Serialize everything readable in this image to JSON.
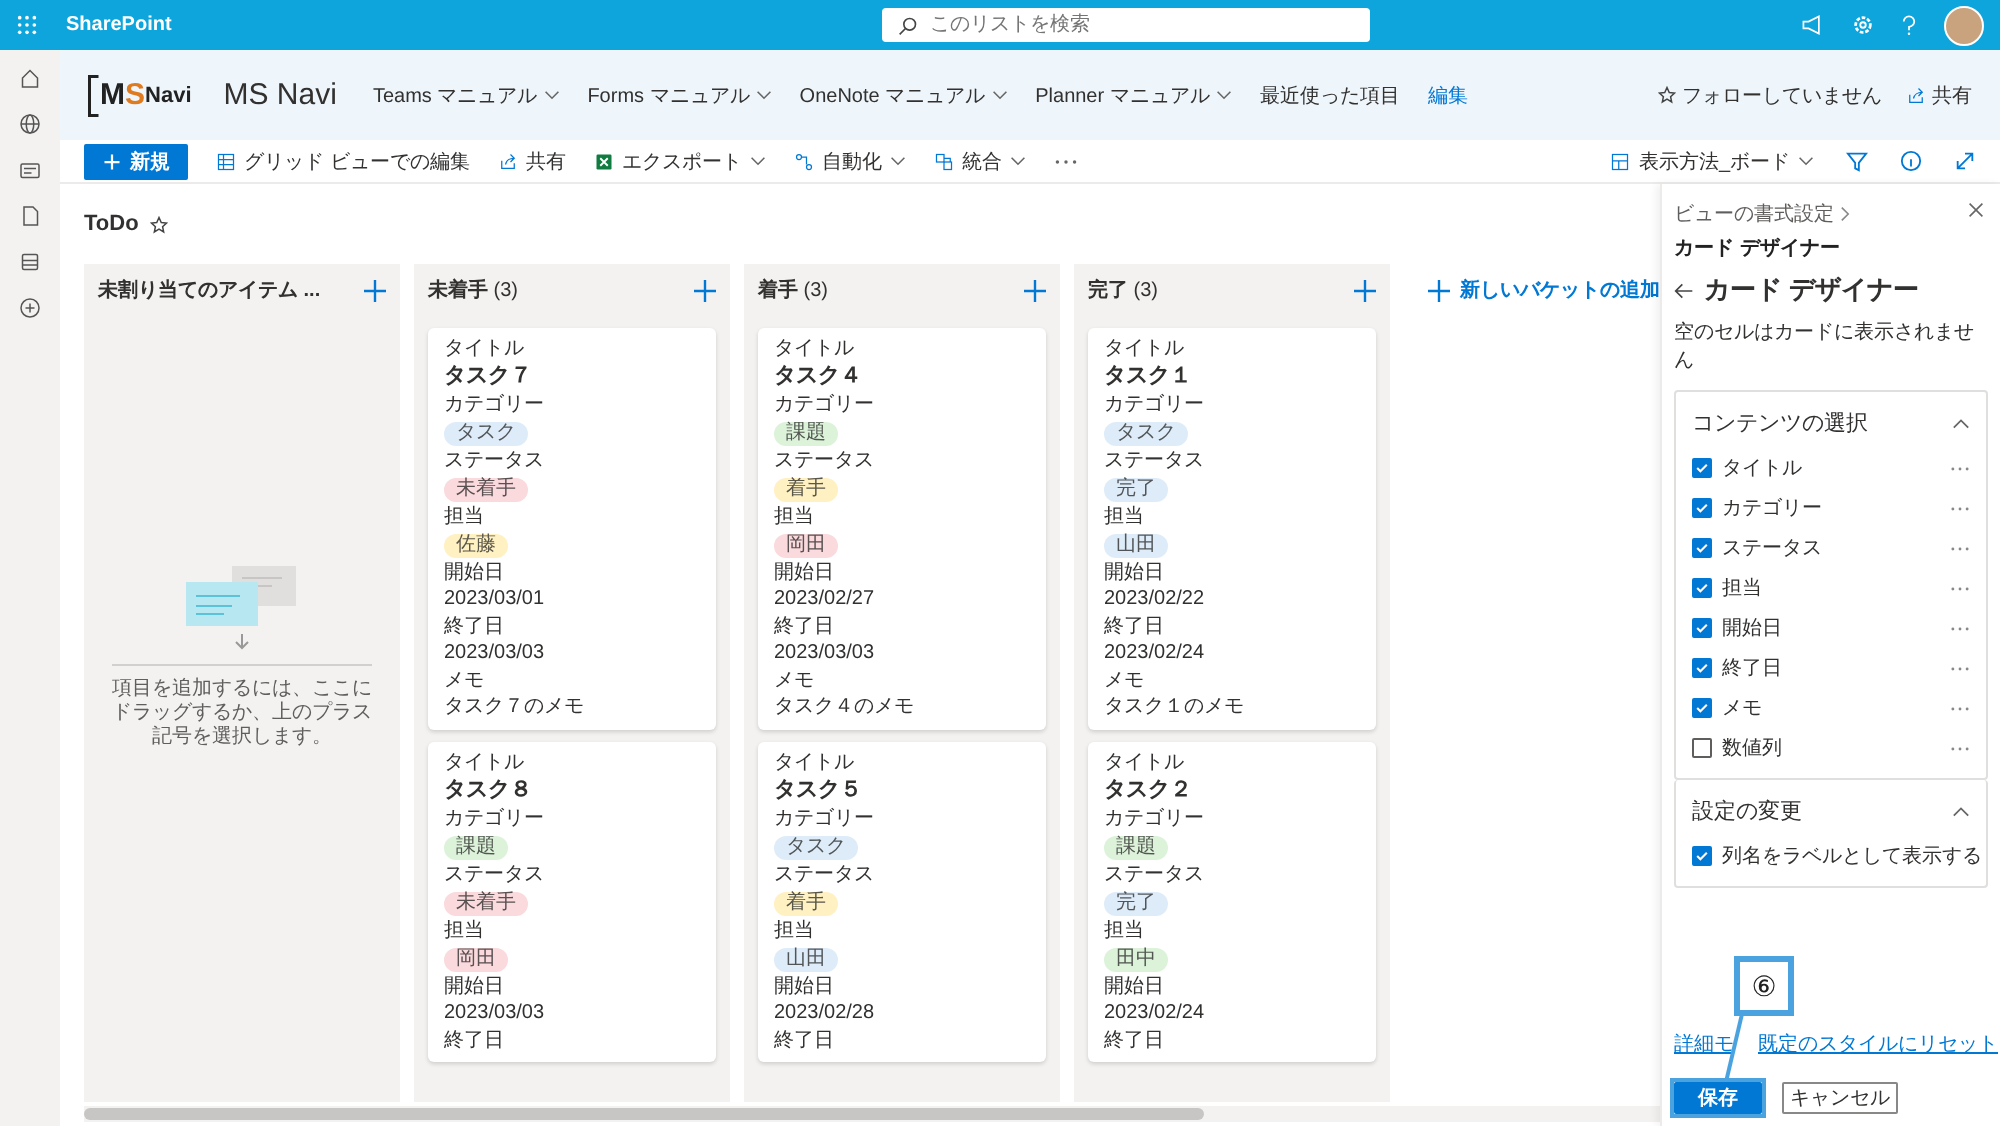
{
  "app_bar": {
    "brand": "SharePoint",
    "search_placeholder": "このリストを検索"
  },
  "site": {
    "logo": [
      "M",
      "S",
      "Navi"
    ],
    "name": "MS Navi",
    "nav": [
      {
        "label": "Teams マニュアル",
        "dropdown": true
      },
      {
        "label": "Forms マニュアル",
        "dropdown": true
      },
      {
        "label": "OneNote マニュアル",
        "dropdown": true
      },
      {
        "label": "Planner マニュアル",
        "dropdown": true
      },
      {
        "label": "最近使った項目",
        "dropdown": false
      }
    ],
    "edit_link": "編集",
    "follow": "フォローしていません",
    "share": "共有"
  },
  "commands": [
    {
      "label": "新規",
      "kind": "primary",
      "dropdown": false
    },
    {
      "label": "グリッド ビューでの編集",
      "kind": "button",
      "dropdown": false
    },
    {
      "label": "共有",
      "kind": "button",
      "dropdown": false
    },
    {
      "label": "エクスポート",
      "kind": "button",
      "dropdown": true
    },
    {
      "label": "自動化",
      "kind": "button",
      "dropdown": true
    },
    {
      "label": "統合",
      "kind": "button",
      "dropdown": true
    }
  ],
  "view_switcher": "表示方法_ボード",
  "list_title": "ToDo",
  "board": {
    "columns": [
      {
        "title": "未割り当てのアイテム ...",
        "empty_text": "項目を追加するには、ここにドラッグするか、上のプラス記号を選択します。"
      },
      {
        "title": "未着手",
        "count": "(3)",
        "cards": [
          {
            "fields": [
              {
                "label": "タイトル",
                "value": "タスク７",
                "kind": "title"
              },
              {
                "label": "カテゴリー",
                "value": "タスク",
                "kind": "tag",
                "color": "#deecf9"
              },
              {
                "label": "ステータス",
                "value": "未着手",
                "kind": "tag",
                "color": "#fadadd"
              },
              {
                "label": "担当",
                "value": "佐藤",
                "kind": "tag",
                "color": "#fff1c2"
              },
              {
                "label": "開始日",
                "value": "2023/03/01",
                "kind": "text"
              },
              {
                "label": "終了日",
                "value": "2023/03/03",
                "kind": "text"
              },
              {
                "label": "メモ",
                "value": "タスク７のメモ",
                "kind": "text"
              }
            ]
          },
          {
            "fields": [
              {
                "label": "タイトル",
                "value": "タスク８",
                "kind": "title"
              },
              {
                "label": "カテゴリー",
                "value": "課題",
                "kind": "tag",
                "color": "#dcf3da"
              },
              {
                "label": "ステータス",
                "value": "未着手",
                "kind": "tag",
                "color": "#fadadd"
              },
              {
                "label": "担当",
                "value": "岡田",
                "kind": "tag",
                "color": "#fadadd"
              },
              {
                "label": "開始日",
                "value": "2023/03/03",
                "kind": "text"
              },
              {
                "label": "終了日"
              }
            ]
          }
        ]
      },
      {
        "title": "着手",
        "count": "(3)",
        "cards": [
          {
            "fields": [
              {
                "label": "タイトル",
                "value": "タスク４",
                "kind": "title"
              },
              {
                "label": "カテゴリー",
                "value": "課題",
                "kind": "tag",
                "color": "#dcf3da"
              },
              {
                "label": "ステータス",
                "value": "着手",
                "kind": "tag",
                "color": "#fff1c2"
              },
              {
                "label": "担当",
                "value": "岡田",
                "kind": "tag",
                "color": "#fadadd"
              },
              {
                "label": "開始日",
                "value": "2023/02/27",
                "kind": "text"
              },
              {
                "label": "終了日",
                "value": "2023/03/03",
                "kind": "text"
              },
              {
                "label": "メモ",
                "value": "タスク４のメモ",
                "kind": "text"
              }
            ]
          },
          {
            "fields": [
              {
                "label": "タイトル",
                "value": "タスク５",
                "kind": "title"
              },
              {
                "label": "カテゴリー",
                "value": "タスク",
                "kind": "tag",
                "color": "#deecf9"
              },
              {
                "label": "ステータス",
                "value": "着手",
                "kind": "tag",
                "color": "#fff1c2"
              },
              {
                "label": "担当",
                "value": "山田",
                "kind": "tag",
                "color": "#deecf9"
              },
              {
                "label": "開始日",
                "value": "2023/02/28",
                "kind": "text"
              },
              {
                "label": "終了日"
              }
            ]
          }
        ]
      },
      {
        "title": "完了",
        "count": "(3)",
        "cards": [
          {
            "fields": [
              {
                "label": "タイトル",
                "value": "タスク１",
                "kind": "title"
              },
              {
                "label": "カテゴリー",
                "value": "タスク",
                "kind": "tag",
                "color": "#deecf9"
              },
              {
                "label": "ステータス",
                "value": "完了",
                "kind": "tag",
                "color": "#deecf9"
              },
              {
                "label": "担当",
                "value": "山田",
                "kind": "tag",
                "color": "#deecf9"
              },
              {
                "label": "開始日",
                "value": "2023/02/22",
                "kind": "text"
              },
              {
                "label": "終了日",
                "value": "2023/02/24",
                "kind": "text"
              },
              {
                "label": "メモ",
                "value": "タスク１のメモ",
                "kind": "text"
              }
            ]
          },
          {
            "fields": [
              {
                "label": "タイトル",
                "value": "タスク２",
                "kind": "title"
              },
              {
                "label": "カテゴリー",
                "value": "課題",
                "kind": "tag",
                "color": "#dcf3da"
              },
              {
                "label": "ステータス",
                "value": "完了",
                "kind": "tag",
                "color": "#deecf9"
              },
              {
                "label": "担当",
                "value": "田中",
                "kind": "tag",
                "color": "#dcf3da"
              },
              {
                "label": "開始日",
                "value": "2023/02/24",
                "kind": "text"
              },
              {
                "label": "終了日"
              }
            ]
          }
        ]
      }
    ],
    "add_bucket": "新しいバケットの追加"
  },
  "panel": {
    "breadcrumb": [
      "ビューの書式設定",
      "カード デザイナー"
    ],
    "title": "カード デザイナー",
    "note": "空のセルはカードに表示されません",
    "sections": [
      {
        "title": "コンテンツの選択",
        "expanded": true,
        "items": [
          {
            "label": "タイトル",
            "checked": true
          },
          {
            "label": "カテゴリー",
            "checked": true
          },
          {
            "label": "ステータス",
            "checked": true
          },
          {
            "label": "担当",
            "checked": true
          },
          {
            "label": "開始日",
            "checked": true
          },
          {
            "label": "終了日",
            "checked": true
          },
          {
            "label": "メモ",
            "checked": true
          },
          {
            "label": "数値列",
            "checked": false
          }
        ]
      },
      {
        "title": "設定の変更",
        "expanded": true,
        "items": [
          {
            "label": "列名をラベルとして表示する",
            "checked": true
          }
        ]
      }
    ],
    "links": [
      "詳細モ",
      "既定のスタイルにリセット"
    ],
    "buttons": [
      {
        "label": "保存",
        "kind": "primary"
      },
      {
        "label": "キャンセル",
        "kind": "default"
      }
    ],
    "callout": "⑥"
  }
}
